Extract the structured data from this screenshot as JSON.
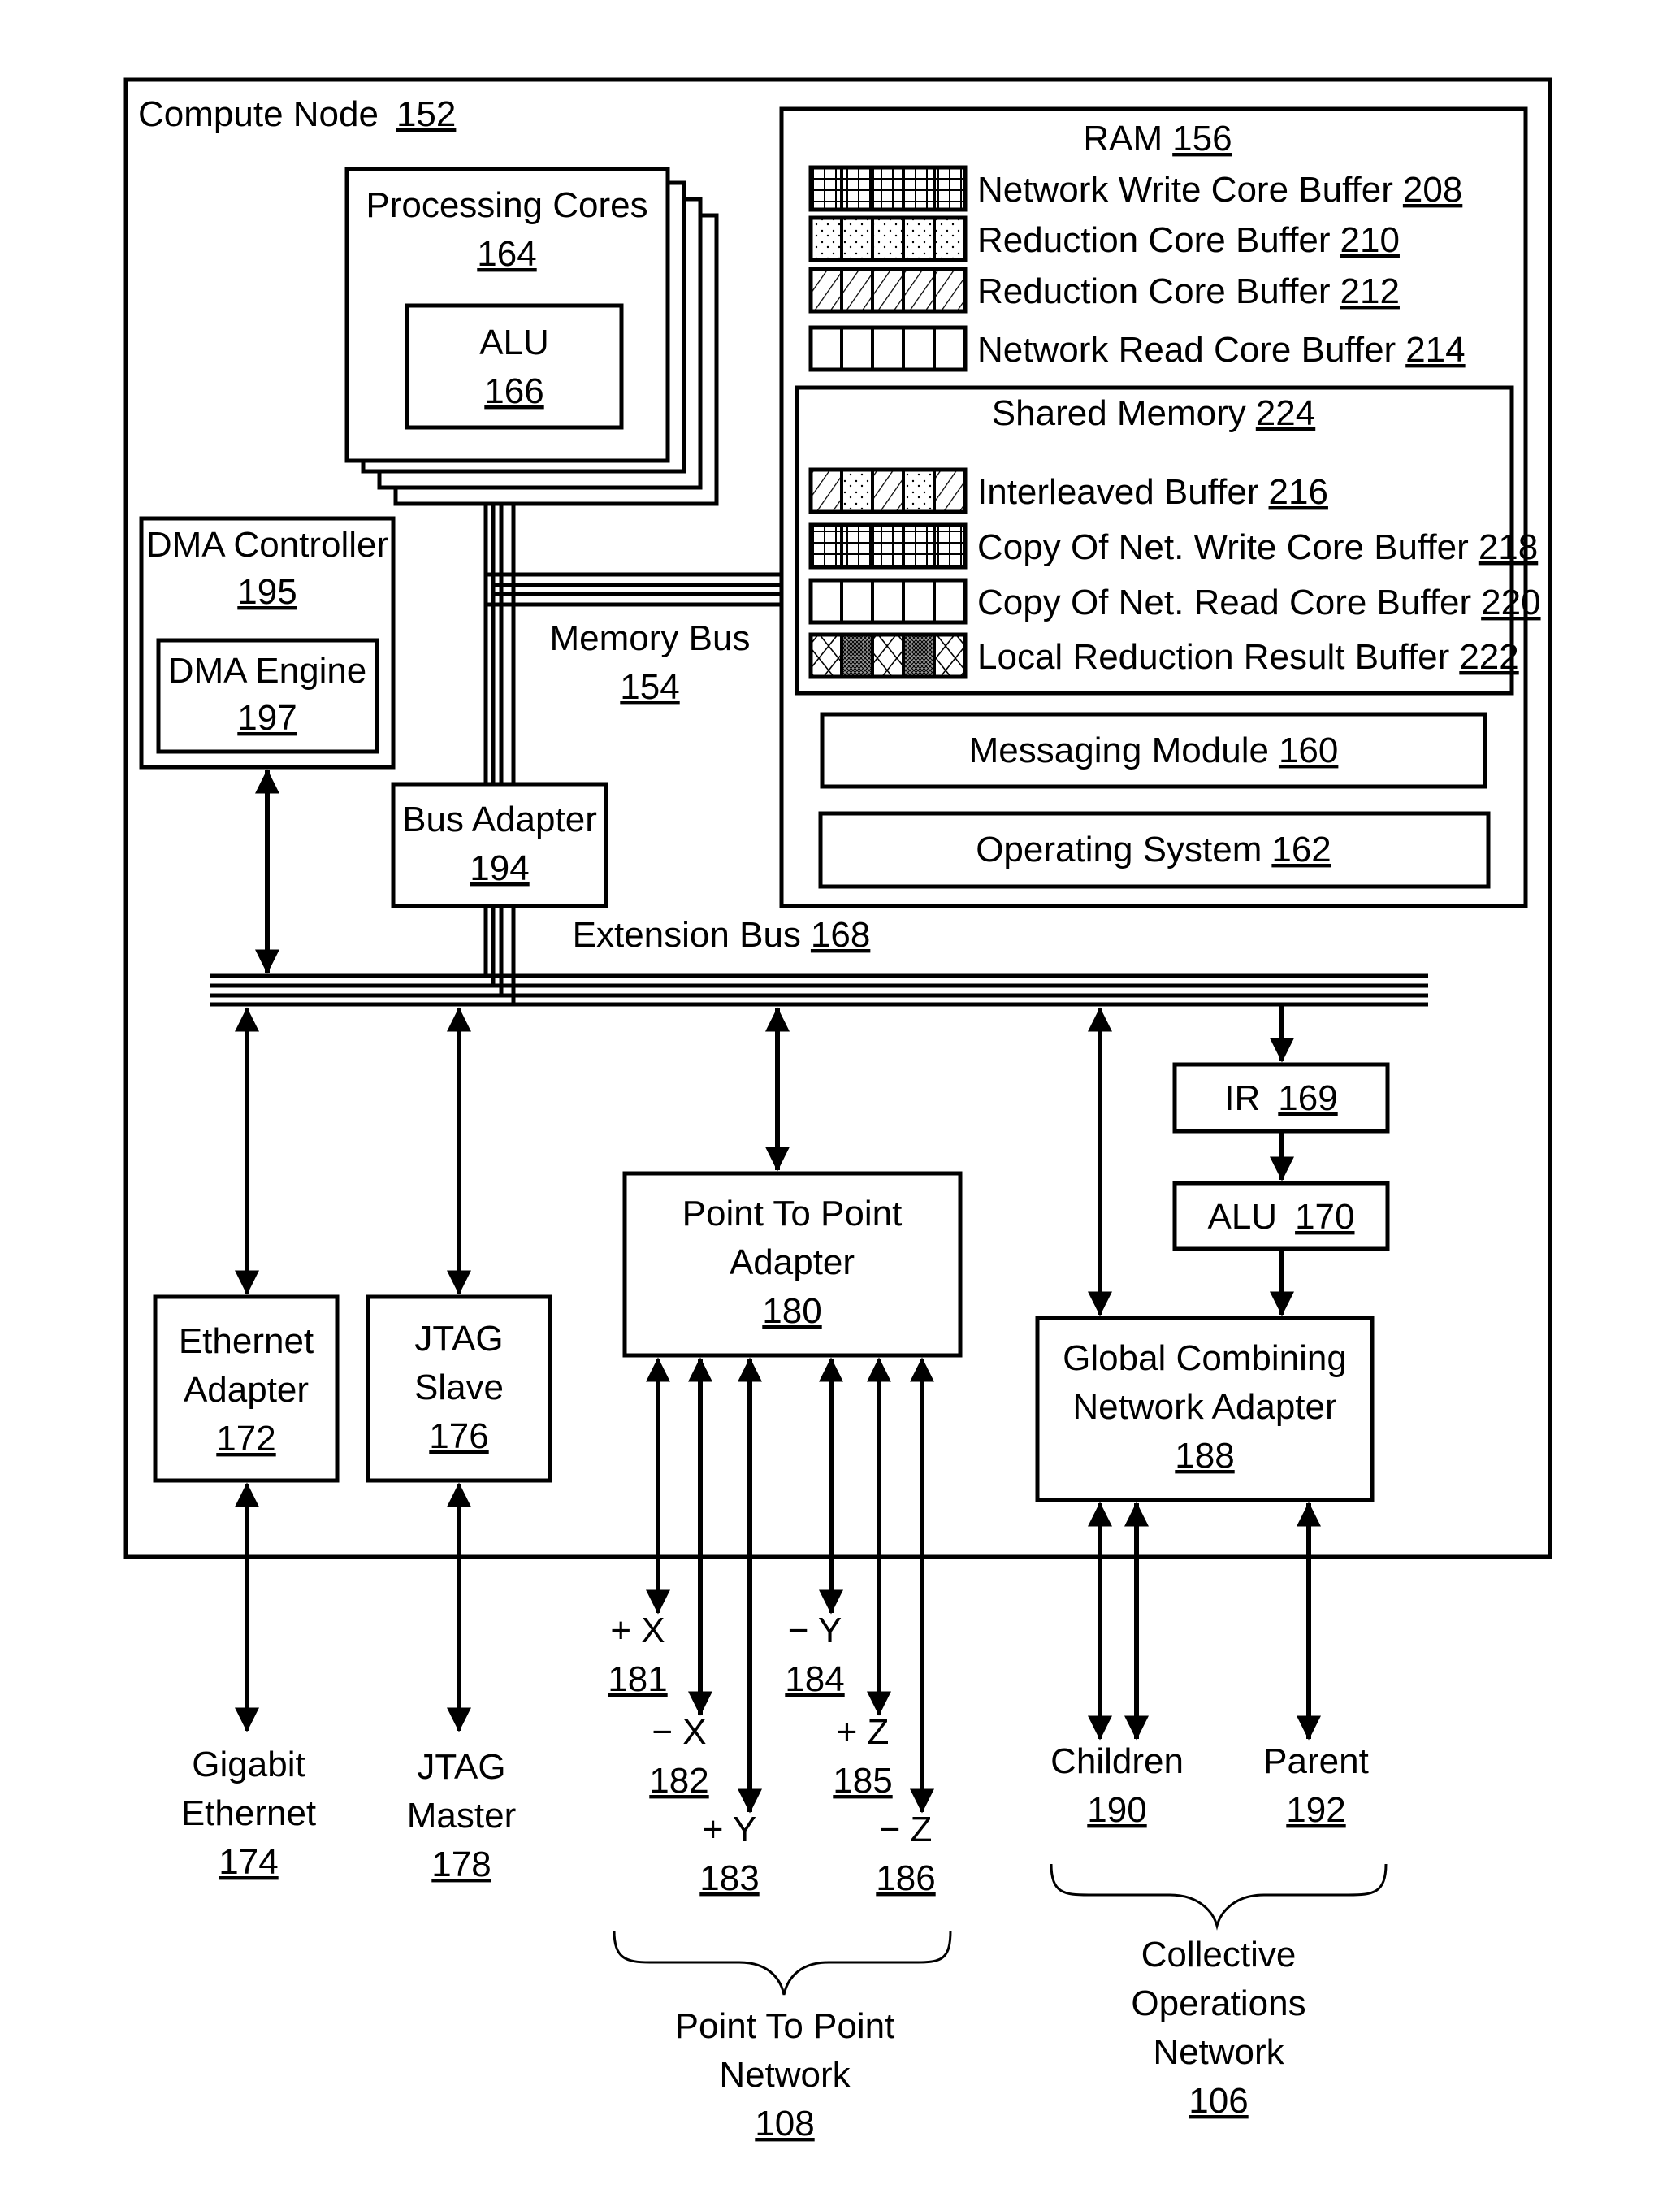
{
  "compute_node": {
    "label": "Compute Node",
    "ref": "152"
  },
  "processing_cores": {
    "label": "Processing Cores",
    "ref": "164"
  },
  "alu_core": {
    "label": "ALU",
    "ref": "166"
  },
  "dma_controller": {
    "label": "DMA Controller",
    "ref": "195"
  },
  "dma_engine": {
    "label": "DMA Engine",
    "ref": "197"
  },
  "memory_bus": {
    "label": "Memory Bus",
    "ref": "154"
  },
  "bus_adapter": {
    "label": "Bus Adapter",
    "ref": "194"
  },
  "extension_bus": {
    "label": "Extension Bus",
    "ref": "168"
  },
  "ram": {
    "label": "RAM",
    "ref": "156",
    "buffers": [
      {
        "label": "Network Write Core Buffer",
        "ref": "208",
        "pattern": "grid"
      },
      {
        "label": "Reduction Core Buffer",
        "ref": "210",
        "pattern": "dots"
      },
      {
        "label": "Reduction Core Buffer",
        "ref": "212",
        "pattern": "hatch"
      },
      {
        "label": "Network Read Core Buffer",
        "ref": "214",
        "pattern": "empty"
      }
    ]
  },
  "shared_memory": {
    "label": "Shared Memory",
    "ref": "224",
    "buffers": [
      {
        "label": "Interleaved Buffer",
        "ref": "216",
        "pattern": "interleaved"
      },
      {
        "label": "Copy Of Net. Write Core Buffer",
        "ref": "218",
        "pattern": "grid"
      },
      {
        "label": "Copy Of Net. Read Core Buffer",
        "ref": "220",
        "pattern": "empty"
      },
      {
        "label": "Local Reduction Result Buffer",
        "ref": "222",
        "pattern": "crosshatch"
      }
    ]
  },
  "messaging_module": {
    "label": "Messaging Module",
    "ref": "160"
  },
  "operating_system": {
    "label": "Operating System",
    "ref": "162"
  },
  "ethernet_adapter": {
    "line1": "Ethernet",
    "line2": "Adapter",
    "ref": "172"
  },
  "jtag_slave": {
    "line1": "JTAG",
    "line2": "Slave",
    "ref": "176"
  },
  "p2p_adapter": {
    "line1": "Point To Point",
    "line2": "Adapter",
    "ref": "180"
  },
  "ir": {
    "label": "IR",
    "ref": "169"
  },
  "alu_net": {
    "label": "ALU",
    "ref": "170"
  },
  "gcna": {
    "line1": "Global Combining",
    "line2": "Network Adapter",
    "ref": "188"
  },
  "gigabit_ethernet": {
    "line1": "Gigabit",
    "line2": "Ethernet",
    "ref": "174"
  },
  "jtag_master": {
    "line1": "JTAG",
    "line2": "Master",
    "ref": "178"
  },
  "links": [
    {
      "label": "+ X",
      "ref": "181"
    },
    {
      "label": "− X",
      "ref": "182"
    },
    {
      "label": "+ Y",
      "ref": "183"
    },
    {
      "label": "− Y",
      "ref": "184"
    },
    {
      "label": "+ Z",
      "ref": "185"
    },
    {
      "label": "− Z",
      "ref": "186"
    }
  ],
  "children": {
    "label": "Children",
    "ref": "190"
  },
  "parent": {
    "label": "Parent",
    "ref": "192"
  },
  "p2p_network": {
    "line1": "Point To Point",
    "line2": "Network",
    "ref": "108"
  },
  "collective_network": {
    "line1": "Collective",
    "line2": "Operations",
    "line3": "Network",
    "ref": "106"
  }
}
